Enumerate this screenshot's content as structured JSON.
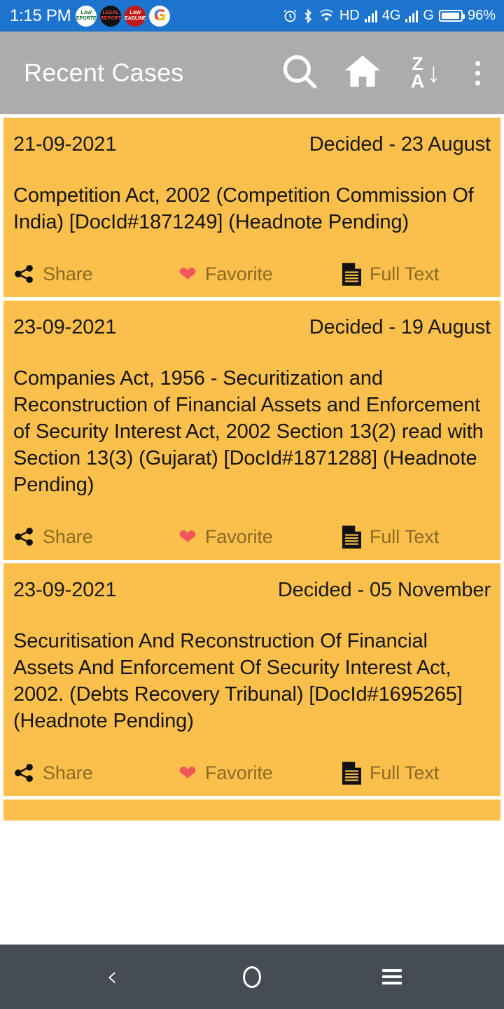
{
  "status_bar": {
    "time": "1:15 PM",
    "notification_apps": [
      {
        "name": "law-reporter",
        "short": "LAW REPORTER"
      },
      {
        "name": "legal-report",
        "short": "LEGAL REPORT"
      },
      {
        "name": "law-headlines",
        "short": "LAW HEADLINES"
      },
      {
        "name": "google",
        "short": "G"
      }
    ],
    "icons": [
      "alarm-icon",
      "bluetooth-icon",
      "wifi-icon",
      "signal-bars-icon",
      "signal-bars-icon",
      "battery-icon"
    ],
    "hd_label": "HD",
    "network_label": "4G",
    "network_label_2": "G",
    "battery_percent": "96%",
    "background_color": "#1C74CE"
  },
  "app_bar": {
    "title": "Recent Cases",
    "background_color": "#ACACAC",
    "actions": [
      {
        "name": "search",
        "label": "Search"
      },
      {
        "name": "home",
        "label": "Home"
      },
      {
        "name": "sort-descending",
        "label": "Sort Z to A",
        "letter_top": "Z",
        "letter_bottom": "A",
        "arrow": "↓"
      },
      {
        "name": "overflow-menu",
        "label": "More options"
      }
    ]
  },
  "card_actions": {
    "share_label": "Share",
    "favorite_label": "Favorite",
    "full_text_label": "Full Text",
    "label_color": "#8A6B22",
    "heart_color": "#F2555A"
  },
  "list": {
    "card_background": "#FBBF4C",
    "cases": [
      {
        "date": "21-09-2021",
        "decided": "Decided - 23 August",
        "title": "Competition Act, 2002 (Competition Commission Of India) [DocId#1871249] (Headnote Pending)"
      },
      {
        "date": "23-09-2021",
        "decided": "Decided - 19 August",
        "title": "Companies Act, 1956 - Securitization and Reconstruction of Financial Assets and Enforcement of Security Interest Act, 2002 Section 13(2) read with Section 13(3) (Gujarat) [DocId#1871288] (Headnote Pending)"
      },
      {
        "date": "23-09-2021",
        "decided": "Decided - 05 November",
        "title": "Securitisation And Reconstruction Of Financial Assets And Enforcement Of Security Interest Act, 2002. (Debts Recovery Tribunal) [DocId#1695265] (Headnote Pending)"
      }
    ]
  },
  "nav_bar": {
    "background_color": "#454C54",
    "buttons": [
      {
        "name": "back",
        "label": "Back",
        "glyph": "‹"
      },
      {
        "name": "home",
        "label": "Home"
      },
      {
        "name": "recents",
        "label": "Recents"
      }
    ]
  }
}
